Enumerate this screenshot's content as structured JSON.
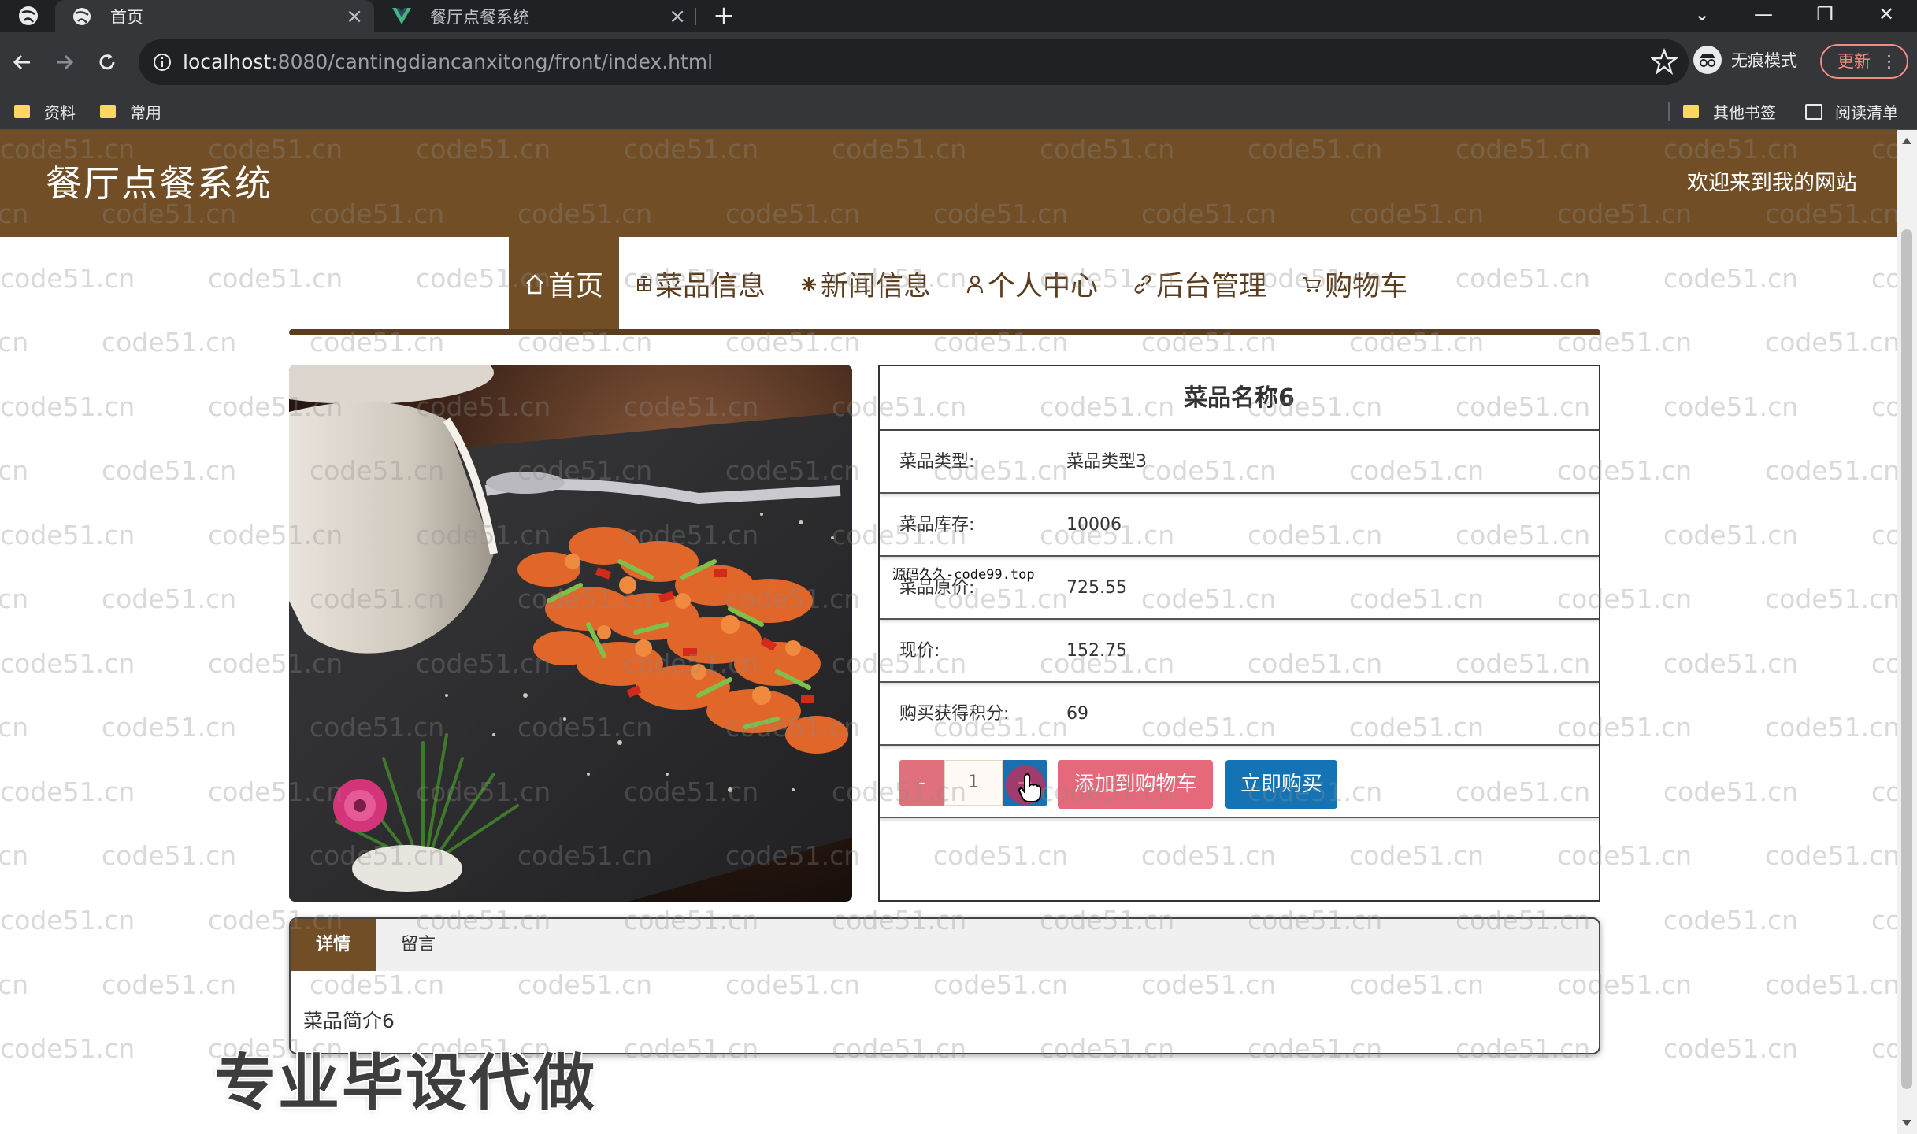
{
  "browser": {
    "tabs": [
      {
        "title": "首页",
        "active": true
      },
      {
        "title": "餐厅点餐系统",
        "active": false
      }
    ],
    "new_tab_symbol": "+",
    "url_host": "localhost",
    "url_rest": ":8080/cantingdiancanxitong/front/index.html",
    "incognito_label": "无痕模式",
    "update_label": "更新",
    "bookmarks": [
      {
        "label": "资料",
        "icon": "folder-icon"
      },
      {
        "label": "常用",
        "icon": "folder-icon"
      }
    ],
    "other_bookmarks_label": "其他书签",
    "reading_list_label": "阅读清单",
    "colors": {
      "tabstrip": "#202124",
      "toolbar": "#35363a",
      "update": "#f28b82"
    }
  },
  "site": {
    "title": "餐厅点餐系统",
    "welcome": "欢迎来到我的网站",
    "colors": {
      "brand": "#724e26",
      "add_to_cart": "#e5697a",
      "buy_now": "#1373b5"
    }
  },
  "nav": {
    "items": [
      {
        "label": "首页",
        "icon": "home-icon",
        "active": true
      },
      {
        "label": "菜品信息",
        "icon": "grid-icon",
        "active": false
      },
      {
        "label": "新闻信息",
        "icon": "asterisk-icon",
        "active": false
      },
      {
        "label": "个人中心",
        "icon": "user-icon",
        "active": false
      },
      {
        "label": "后台管理",
        "icon": "link-icon",
        "active": false
      },
      {
        "label": "购物车",
        "icon": "cart-icon",
        "active": false
      }
    ]
  },
  "product": {
    "name": "菜品名称6",
    "image_alt": "shrimp-dish-photo",
    "fields": [
      {
        "label": "菜品类型:",
        "value": "菜品类型3"
      },
      {
        "label": "菜品库存:",
        "value": "10006"
      },
      {
        "label": "菜品原价:",
        "value": "725.55"
      },
      {
        "label": "现价:",
        "value": "152.75"
      },
      {
        "label": "购买获得积分:",
        "value": "69"
      }
    ],
    "quantity": "1",
    "minus_label": "-",
    "plus_label": "+",
    "add_to_cart_label": "添加到购物车",
    "buy_now_label": "立即购买"
  },
  "detail": {
    "tabs": [
      "详情",
      "留言"
    ],
    "active_tab": "详情",
    "content": "菜品简介6"
  },
  "overlays": {
    "watermark": "code51.cn",
    "corner_text": "源码久久-code99.top",
    "promo": "专业毕设代做"
  }
}
